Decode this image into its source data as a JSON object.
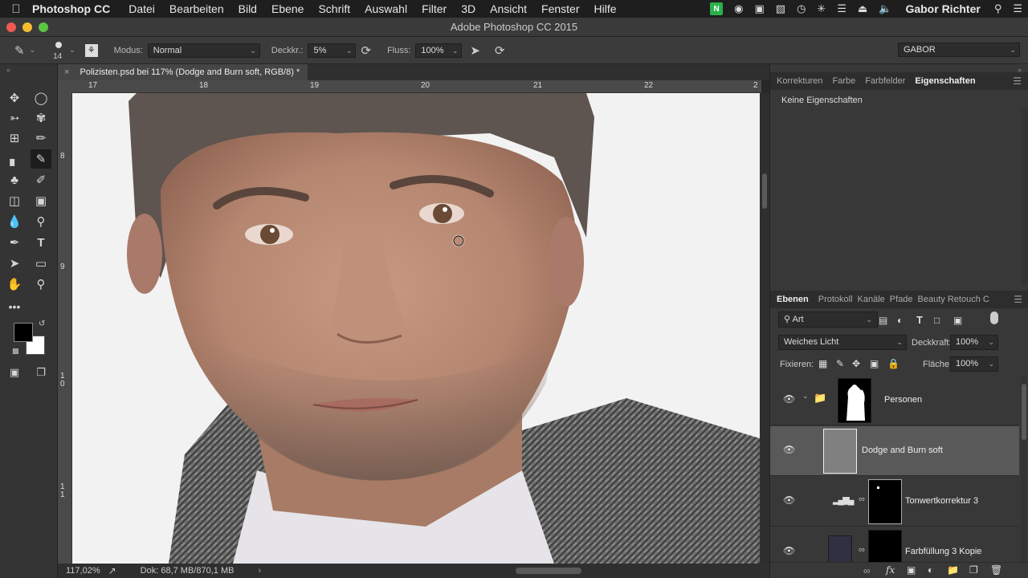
{
  "menubar": {
    "app_name": "Photoshop CC",
    "items": [
      "Datei",
      "Bearbeiten",
      "Bild",
      "Ebene",
      "Schrift",
      "Auswahl",
      "Filter",
      "3D",
      "Ansicht",
      "Fenster",
      "Hilfe"
    ],
    "user": "Gabor Richter"
  },
  "window": {
    "title": "Adobe Photoshop CC 2015"
  },
  "options_bar": {
    "brush_size": "14",
    "mode_label": "Modus:",
    "mode_value": "Normal",
    "opacity_label": "Deckkr.:",
    "opacity_value": "5%",
    "flow_label": "Fluss:",
    "flow_value": "100%",
    "workspace": "GABOR"
  },
  "document": {
    "tab_title": "Polizisten.psd bei 117% (Dodge and Burn soft, RGB/8) *",
    "ruler_h": [
      "17",
      "18",
      "19",
      "20",
      "21",
      "22",
      "2"
    ],
    "ruler_v": [
      "8",
      "9",
      "10",
      "11"
    ]
  },
  "status": {
    "zoom": "117,02%",
    "doc_info": "Dok: 68,7 MB/870,1 MB"
  },
  "properties_panel": {
    "tabs": [
      "Korrekturen",
      "Farbe",
      "Farbfelder",
      "Eigenschaften"
    ],
    "active_tab": "Eigenschaften",
    "content": "Keine Eigenschaften"
  },
  "layers_panel": {
    "tabs": [
      "Ebenen",
      "Protokoll",
      "Kanäle",
      "Pfade",
      "Beauty Retouch C"
    ],
    "active_tab": "Ebenen",
    "filter_kind": "Art",
    "blend_mode": "Weiches Licht",
    "opacity_label": "Deckkraft:",
    "opacity_value": "100%",
    "lock_label": "Fixieren:",
    "fill_label": "Fläche:",
    "fill_value": "100%",
    "layers": [
      {
        "name": "Personen",
        "type": "group"
      },
      {
        "name": "Dodge and Burn soft",
        "type": "pixel",
        "selected": true
      },
      {
        "name": "Tonwertkorrektur 3",
        "type": "adjustment"
      },
      {
        "name": "Farbfüllung 3 Kopie",
        "type": "fill"
      }
    ]
  },
  "colors": {
    "foreground": "#000000",
    "background": "#ffffff"
  }
}
